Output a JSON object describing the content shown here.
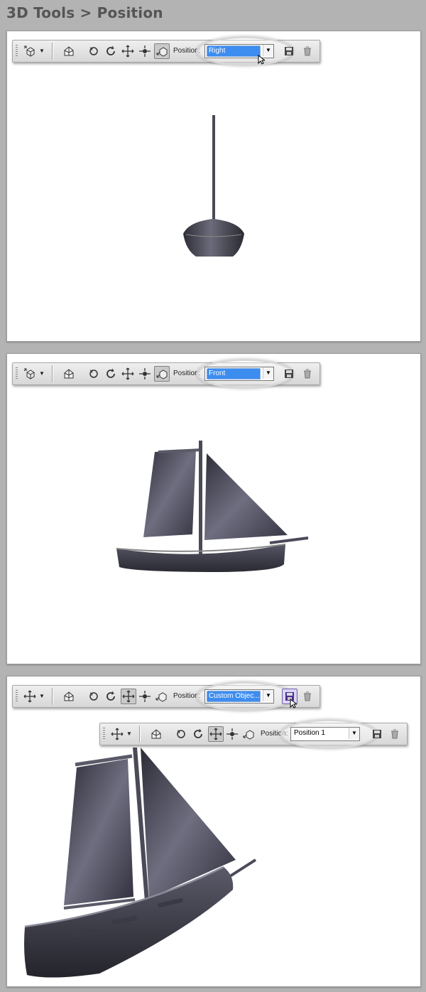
{
  "page": {
    "title": "3D Tools > Position"
  },
  "toolbar": {
    "position_label": "Position:",
    "icons": [
      "object-camera-icon",
      "return-home-icon",
      "rotate-icon",
      "roll-icon",
      "drag-icon",
      "slide-icon",
      "scale-icon",
      "save-position-icon",
      "delete-position-icon"
    ]
  },
  "panels": [
    {
      "position_value": "Right"
    },
    {
      "position_value": "Front"
    },
    {
      "position_value": "Custom Objec...",
      "secondary_position_value": "Position 1"
    }
  ],
  "colors": {
    "highlight": "#3d8df0",
    "model": "#4a4a58",
    "background": "#b3b3b3"
  }
}
